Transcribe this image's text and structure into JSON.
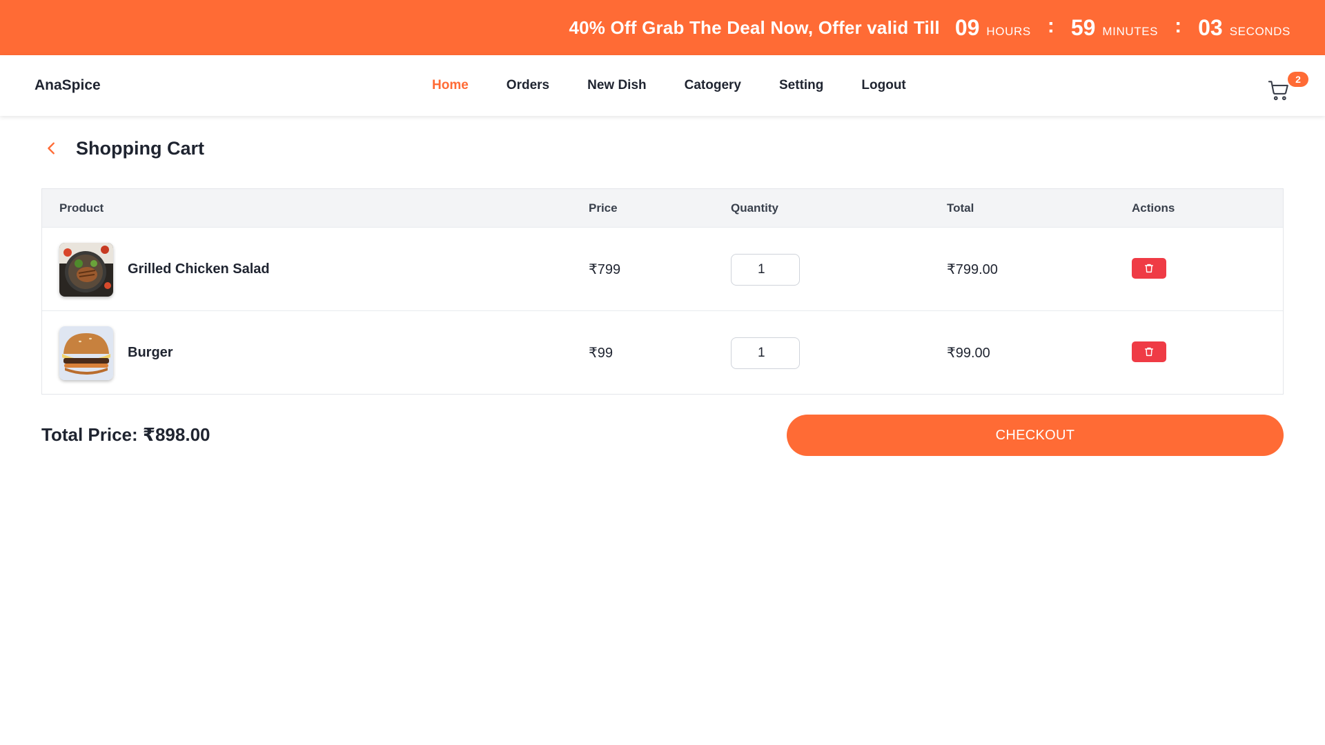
{
  "promo": {
    "text": "40% Off Grab The Deal Now, Offer valid Till",
    "hours": "09",
    "hours_label": "HOURS",
    "minutes": "59",
    "minutes_label": "MINUTES",
    "seconds": "03",
    "seconds_label": "SECONDS",
    "separator": ":"
  },
  "nav": {
    "brand": "AnaSpice",
    "links": [
      "Home",
      "Orders",
      "New Dish",
      "Catogery",
      "Setting",
      "Logout"
    ],
    "active": "Home",
    "cart_count": "2"
  },
  "page": {
    "title": "Shopping Cart"
  },
  "table": {
    "headers": {
      "product": "Product",
      "price": "Price",
      "quantity": "Quantity",
      "total": "Total",
      "actions": "Actions"
    },
    "rows": [
      {
        "name": "Grilled Chicken Salad",
        "price": "₹799",
        "quantity": "1",
        "total": "₹799.00"
      },
      {
        "name": "Burger",
        "price": "₹99",
        "quantity": "1",
        "total": "₹99.00"
      }
    ]
  },
  "summary": {
    "total_price": "Total Price: ₹898.00",
    "checkout_label": "CHECKOUT"
  },
  "colors": {
    "brand": "#ff6b35",
    "delete": "#ef3b45",
    "header_bg": "#f3f4f6"
  }
}
